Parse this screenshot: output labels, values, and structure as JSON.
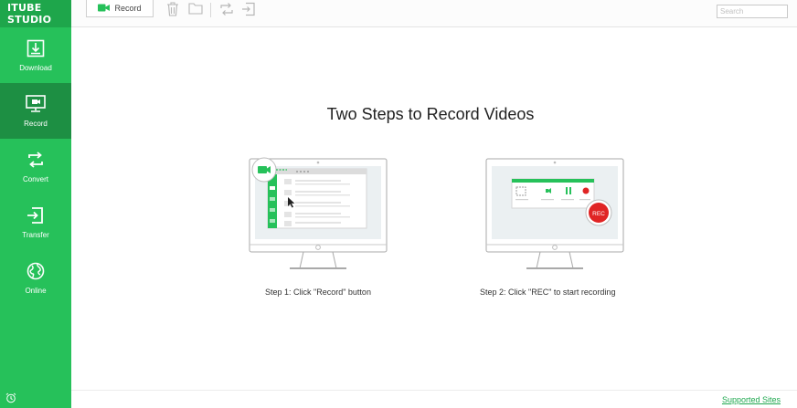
{
  "app": {
    "brand": "ITUBE STUDIO"
  },
  "sidebar": {
    "items": [
      {
        "label": "Download",
        "icon": "download-icon",
        "active": false
      },
      {
        "label": "Record",
        "icon": "record-monitor-icon",
        "active": true
      },
      {
        "label": "Convert",
        "icon": "convert-icon",
        "active": false
      },
      {
        "label": "Transfer",
        "icon": "transfer-icon",
        "active": false
      },
      {
        "label": "Online",
        "icon": "globe-icon",
        "active": false
      }
    ],
    "bottom_icon": "alarm-clock-icon"
  },
  "toolbar": {
    "record_label": "Record",
    "tools": [
      "trash-icon",
      "folder-icon",
      "repeat-icon",
      "import-icon"
    ],
    "search_placeholder": "Search"
  },
  "main": {
    "title": "Two Steps to Record Videos",
    "steps": [
      {
        "caption": "Step 1: Click \"Record\" button"
      },
      {
        "caption": "Step 2: Click \"REC\" to start recording"
      }
    ],
    "rec_badge": "REC"
  },
  "footer": {
    "supported_sites": "Supported Sites"
  },
  "colors": {
    "sidebar_green": "#26c15a",
    "sidebar_active": "#1d8f43",
    "rec_red": "#e02424"
  }
}
